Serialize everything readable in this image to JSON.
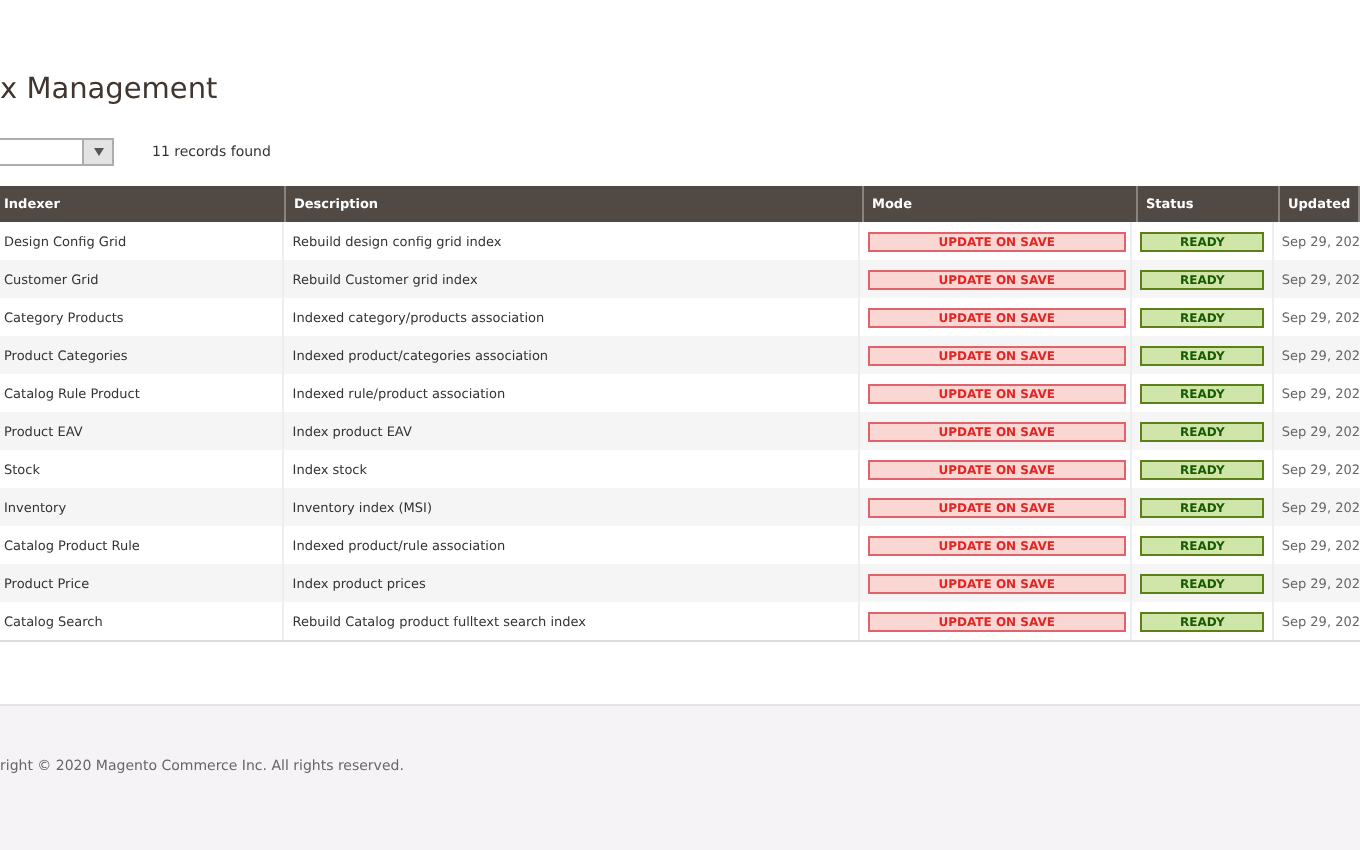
{
  "page_title": "x Management",
  "toolbar": {
    "records_found": "11 records found"
  },
  "table": {
    "columns": [
      "Indexer",
      "Description",
      "Mode",
      "Status",
      "Updated"
    ],
    "rows": [
      {
        "indexer": "Design Config Grid",
        "description": "Rebuild design config grid index",
        "mode": {
          "label": "UPDATE ON SAVE",
          "kind": "on-save"
        },
        "status": {
          "label": "READY",
          "kind": "ready"
        },
        "updated": "Sep 29, 202"
      },
      {
        "indexer": "Customer Grid",
        "description": "Rebuild Customer grid index",
        "mode": {
          "label": "UPDATE ON SAVE",
          "kind": "on-save"
        },
        "status": {
          "label": "READY",
          "kind": "ready"
        },
        "updated": "Sep 29, 202"
      },
      {
        "indexer": "Category Products",
        "description": "Indexed category/products association",
        "mode": {
          "label": "UPDATE ON SAVE",
          "kind": "on-save"
        },
        "status": {
          "label": "READY",
          "kind": "ready"
        },
        "updated": "Sep 29, 202"
      },
      {
        "indexer": "Product Categories",
        "description": "Indexed product/categories association",
        "mode": {
          "label": "UPDATE ON SAVE",
          "kind": "on-save"
        },
        "status": {
          "label": "READY",
          "kind": "ready"
        },
        "updated": "Sep 29, 202"
      },
      {
        "indexer": "Catalog Rule Product",
        "description": "Indexed rule/product association",
        "mode": {
          "label": "UPDATE ON SAVE",
          "kind": "on-save"
        },
        "status": {
          "label": "READY",
          "kind": "ready"
        },
        "updated": "Sep 29, 202"
      },
      {
        "indexer": "Product EAV",
        "description": "Index product EAV",
        "mode": {
          "label": "UPDATE ON SAVE",
          "kind": "on-save"
        },
        "status": {
          "label": "READY",
          "kind": "ready"
        },
        "updated": "Sep 29, 202"
      },
      {
        "indexer": "Stock",
        "description": "Index stock",
        "mode": {
          "label": "UPDATE ON SAVE",
          "kind": "on-save"
        },
        "status": {
          "label": "READY",
          "kind": "ready"
        },
        "updated": "Sep 29, 202"
      },
      {
        "indexer": "Inventory",
        "description": "Inventory index (MSI)",
        "mode": {
          "label": "UPDATE ON SAVE",
          "kind": "on-save"
        },
        "status": {
          "label": "READY",
          "kind": "ready"
        },
        "updated": "Sep 29, 202"
      },
      {
        "indexer": "Catalog Product Rule",
        "description": "Indexed product/rule association",
        "mode": {
          "label": "UPDATE ON SAVE",
          "kind": "on-save"
        },
        "status": {
          "label": "READY",
          "kind": "ready"
        },
        "updated": "Sep 29, 202"
      },
      {
        "indexer": "Product Price",
        "description": "Index product prices",
        "mode": {
          "label": "UPDATE ON SAVE",
          "kind": "on-save"
        },
        "status": {
          "label": "READY",
          "kind": "ready"
        },
        "updated": "Sep 29, 202"
      },
      {
        "indexer": "Catalog Search",
        "description": "Rebuild Catalog product fulltext search index",
        "mode": {
          "label": "UPDATE ON SAVE",
          "kind": "on-save"
        },
        "status": {
          "label": "READY",
          "kind": "ready"
        },
        "updated": "Sep 29, 202"
      }
    ]
  },
  "footer": {
    "copyright": "right © 2020 Magento Commerce Inc. All rights reserved."
  }
}
